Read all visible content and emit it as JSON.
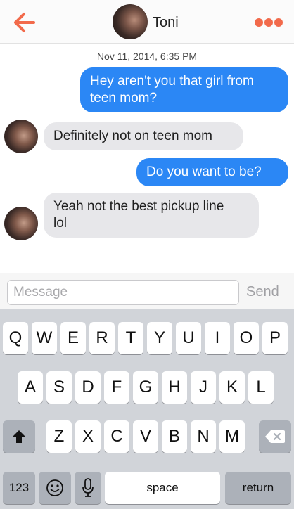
{
  "header": {
    "contact_name": "Toni",
    "back_icon": "back-arrow-icon",
    "more_icon": "more-dots-icon",
    "accent_color": "#f26a4b"
  },
  "conversation": {
    "timestamp": "Nov 11, 2014, 6:35 PM",
    "messages": [
      {
        "sender": "me",
        "lines": [
          "Hey aren't you that girl from",
          "teen mom?"
        ]
      },
      {
        "sender": "Toni",
        "lines": [
          "Definitely not on teen mom"
        ]
      },
      {
        "sender": "me",
        "lines": [
          "Do you want to be?"
        ]
      },
      {
        "sender": "Toni",
        "lines": [
          "Yeah not the best pickup line",
          "lol"
        ]
      }
    ]
  },
  "composer": {
    "placeholder": "Message",
    "send_label": "Send"
  },
  "keyboard": {
    "row1": [
      "Q",
      "W",
      "E",
      "R",
      "T",
      "Y",
      "U",
      "I",
      "O",
      "P"
    ],
    "row2": [
      "A",
      "S",
      "D",
      "F",
      "G",
      "H",
      "J",
      "K",
      "L"
    ],
    "row3": [
      "Z",
      "X",
      "C",
      "V",
      "B",
      "N",
      "M"
    ],
    "numbers_label": "123",
    "space_label": "space",
    "return_label": "return"
  },
  "colors": {
    "outgoing_bubble": "#2b87f5",
    "incoming_bubble": "#e7e7ea"
  }
}
